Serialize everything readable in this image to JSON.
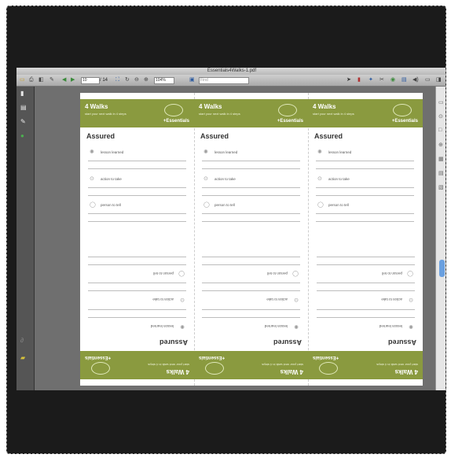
{
  "window": {
    "title": "Essentials4Walks-1.pdf",
    "colors": {
      "frame": "#1b1b1b",
      "toolbar": "#b9b9b9",
      "green": "#8a9a3f",
      "scroll": "#6aa0e0"
    }
  },
  "toolbar": {
    "page_current": "10",
    "page_total": "/ 14",
    "zoom": "104%",
    "search_placeholder": "Find",
    "icons": [
      "sidebar-toggle-icon",
      "print-icon",
      "nav-back-icon",
      "annotate-icon",
      "prev-page-icon",
      "next-page-icon",
      "fit-icon",
      "rotate-icon",
      "zoom-out-icon",
      "zoom-in-icon",
      "search-icon",
      "pointer-icon",
      "highlight-icon",
      "tools-icon"
    ]
  },
  "cards": [
    {
      "header_title": "4 Walks",
      "header_sub": "start your next walk in 4 steps",
      "brand": "+Essentials",
      "assured": "Assured",
      "rows": [
        {
          "label": "lesson learned",
          "icon": "lightbulb-icon"
        },
        {
          "label": "action to take",
          "icon": "play-icon"
        },
        {
          "label": "person to tell",
          "icon": "speech-icon"
        }
      ]
    },
    {
      "header_title": "4 Walks",
      "header_sub": "start your next walk in 4 steps",
      "brand": "+Essentials",
      "assured": "Assured",
      "rows": [
        {
          "label": "lesson learned",
          "icon": "lightbulb-icon"
        },
        {
          "label": "action to take",
          "icon": "play-icon"
        },
        {
          "label": "person to tell",
          "icon": "speech-icon"
        }
      ]
    },
    {
      "header_title": "4 Walks",
      "header_sub": "start your next walk in 4 steps",
      "brand": "+Essentials",
      "assured": "Assured",
      "rows": [
        {
          "label": "lesson learned",
          "icon": "lightbulb-icon"
        },
        {
          "label": "action to take",
          "icon": "play-icon"
        },
        {
          "label": "person to tell",
          "icon": "speech-icon"
        }
      ]
    }
  ]
}
